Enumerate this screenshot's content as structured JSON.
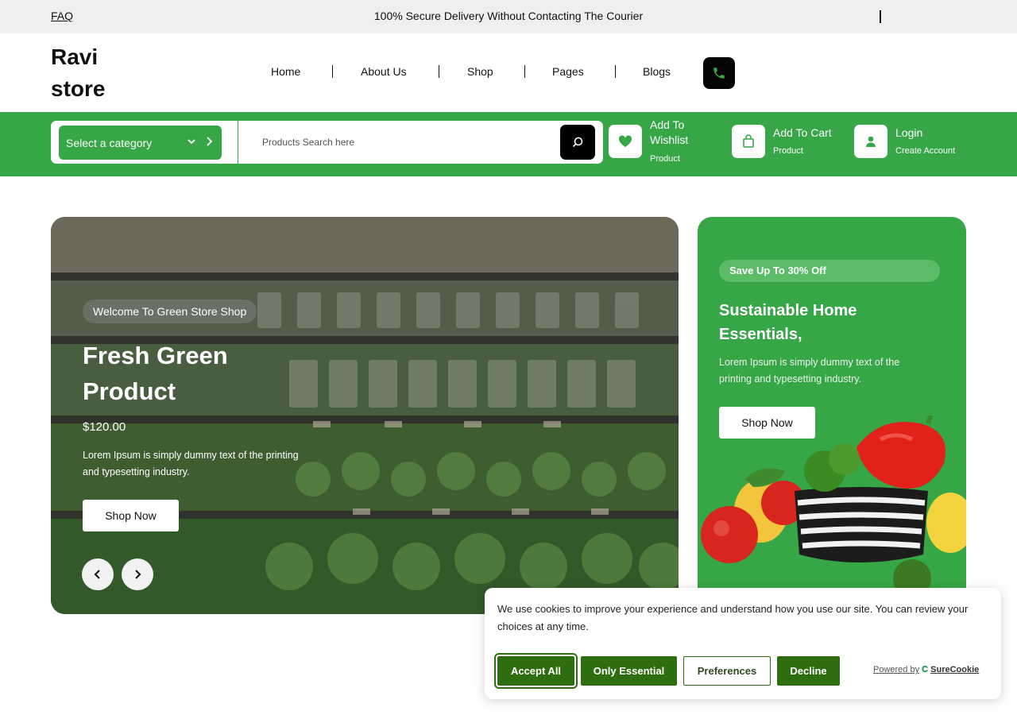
{
  "topbar": {
    "faq": "FAQ",
    "notice": "100% Secure Delivery Without Contacting The Courier"
  },
  "header": {
    "logo": "Ravi store",
    "nav": [
      "Home",
      "About Us",
      "Shop",
      "Pages",
      "Blogs"
    ],
    "phone_icon": "phone-icon"
  },
  "search": {
    "category": "Select a category",
    "placeholder": "Products Search here"
  },
  "quick_links": {
    "wishlist": {
      "title": "Add To Wishlist",
      "sub": "Product",
      "icon": "heart-icon"
    },
    "cart": {
      "title": "Add To Cart",
      "sub": "Product",
      "icon": "shopping-bag-icon"
    },
    "login": {
      "title": "Login",
      "sub": "Create Account",
      "icon": "user-icon"
    }
  },
  "hero": {
    "tag": "Welcome To Green Store Shop",
    "title": "Fresh Green Product",
    "price": "$120.00",
    "description": "Lorem Ipsum is simply dummy text of the printing and typesetting industry.",
    "button": "Shop Now"
  },
  "promo": {
    "tag": "Save Up To 30% Off",
    "title": "Sustainable Home Essentials,",
    "description": "Lorem Ipsum is simply dummy text of the printing and typesetting industry.",
    "button": "Shop Now"
  },
  "cookie": {
    "message": "We use cookies to improve your experience and understand how you use our site. You can review your choices at any time.",
    "buttons": {
      "accept": "Accept All",
      "essential": "Only Essential",
      "preferences": "Preferences",
      "decline": "Decline"
    },
    "powered_by": "Powered by",
    "brand": "SureCookie"
  },
  "colors": {
    "brand_green": "#37a646",
    "cookie_green": "#2f6e10",
    "dark": "#050505"
  }
}
